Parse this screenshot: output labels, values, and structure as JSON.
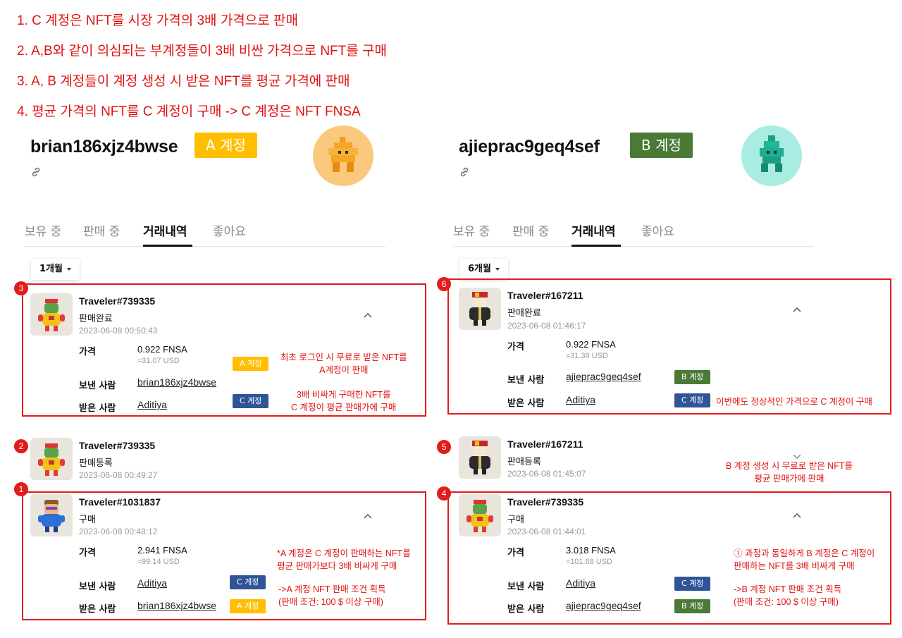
{
  "notes": [
    "1. C 계정은 NFT를 시장 가격의 3배 가격으로 판매",
    "2. A,B와 같이 의심되는 부계정들이 3배 비싼 가격으로 NFT를 구매",
    "3. A, B 계정들이 계정 생성 시 받은  NFT를 평균 가격에 판매",
    "4. 평균 가격의 NFT를 C 계정이 구매 -> C 계정은 NFT FNSA"
  ],
  "colors": {
    "annotation": "#e11212",
    "tag_a": "#ffbf00",
    "tag_b": "#4a7a36",
    "tag_c": "#2f5597",
    "avatar_a_bg": "#fbc97e",
    "avatar_b_bg": "#a8ece2"
  },
  "tabs": [
    "보유 중",
    "판매 중",
    "거래내역",
    "좋아요"
  ],
  "tag_labels": {
    "a": "A 계정",
    "b": "B 계정",
    "c": "C 계정"
  },
  "field_labels": {
    "price": "가격",
    "sender": "보낸 사람",
    "receiver": "받은 사람"
  },
  "left": {
    "username": "brian186xjz4bwse",
    "account_badge": "A 계정",
    "period": "1개월",
    "tx": [
      {
        "num": "3",
        "title": "Traveler#739335",
        "status": "판매완료",
        "time": "2023-06-08 00:50:43",
        "price": "0.922 FNSA",
        "usd": "≈31.07 USD",
        "sender": "brian186xjz4bwse",
        "receiver": "Aditiya",
        "ann1": [
          "최초 로그인 시 무료로 받은 NFT를",
          "A계정이 판매"
        ],
        "ann2": [
          "3배 비싸게 구매한 NFT를",
          "C 계정이 평균 판매가에 구매"
        ]
      },
      {
        "num": "2",
        "title": "Traveler#739335",
        "status": "판매등록",
        "time": "2023-06-08 00:49:27"
      },
      {
        "num": "1",
        "title": "Traveler#1031837",
        "status": "구매",
        "time": "2023-06-08 00:48:12",
        "price": "2.941 FNSA",
        "usd": "≈99.14 USD",
        "sender": "Aditiya",
        "receiver": "brian186xjz4bwse",
        "ann1": [
          "*A 계정은 C 계정이 판매하는 NFT를",
          " 평균 판매가보다 3배 비싸게 구매"
        ],
        "ann2": [
          "->A 계정 NFT 판매 조건 획득",
          "(판매 조건: 100 $ 이상 구매)"
        ]
      }
    ]
  },
  "right": {
    "username": "ajieprac9geq4sef",
    "account_badge": "B 계정",
    "period": "6개월",
    "tx": [
      {
        "num": "6",
        "title": "Traveler#167211",
        "status": "판매완료",
        "time": "2023-06-08 01:46:17",
        "price": "0.922 FNSA",
        "usd": "≈31.38 USD",
        "sender": "ajieprac9geq4sef",
        "receiver": "Aditiya",
        "ann1": "이번에도 정상적인 가격으로 C 계정이 구매"
      },
      {
        "num": "5",
        "title": "Traveler#167211",
        "status": "판매등록",
        "time": "2023-06-08 01:45:07",
        "ann1": [
          "B 계정 생성 시 무료로 받은 NFT를",
          "평균 판매가에 판매"
        ]
      },
      {
        "num": "4",
        "title": "Traveler#739335",
        "status": "구매",
        "time": "2023-06-08 01:44:01",
        "price": "3.018 FNSA",
        "usd": "≈101.68 USD",
        "sender": "Aditiya",
        "receiver": "ajieprac9geq4sef",
        "ann1": [
          "① 과정과 동일하게  B 계정은 C 계정이",
          "판매하는 NFT를 3배 비싸게 구매"
        ],
        "ann2": [
          "->B 계정 NFT 판매 조건 획득",
          "(판매 조건: 100 $ 이상 구매)"
        ]
      }
    ]
  }
}
